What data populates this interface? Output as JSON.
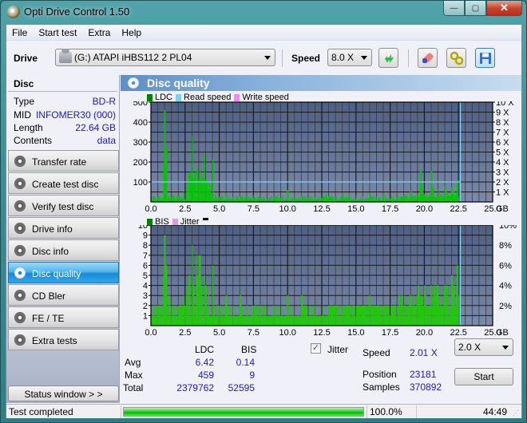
{
  "window": {
    "title": "Opti Drive Control 1.50",
    "buttons": {
      "minimize": "—",
      "maximize": "▢",
      "close": "✕"
    }
  },
  "menu": [
    "File",
    "Start test",
    "Extra",
    "Help"
  ],
  "toolbar": {
    "drive_label": "Drive",
    "drive_value": "(G:)   ATAPI iHBS112   2 PL04",
    "speed_label": "Speed",
    "speed_value": "8.0 X",
    "icons": [
      "refresh-icon",
      "eraser-icon",
      "settings-icon",
      "save-icon"
    ]
  },
  "disc": {
    "heading": "Disc",
    "rows": [
      {
        "label": "Type",
        "value": "BD-R"
      },
      {
        "label": "MID",
        "value": "INFOMER30 (000)"
      },
      {
        "label": "Length",
        "value": "22.64 GB"
      },
      {
        "label": "Contents",
        "value": "data"
      }
    ]
  },
  "nav": {
    "items": [
      {
        "label": "Transfer rate",
        "active": false
      },
      {
        "label": "Create test disc",
        "active": false
      },
      {
        "label": "Verify test disc",
        "active": false
      },
      {
        "label": "Drive info",
        "active": false
      },
      {
        "label": "Disc info",
        "active": false
      },
      {
        "label": "Disc quality",
        "active": true
      },
      {
        "label": "CD Bler",
        "active": false
      },
      {
        "label": "FE / TE",
        "active": false
      },
      {
        "label": "Extra tests",
        "active": false
      }
    ],
    "status_window": "Status window > >"
  },
  "section": {
    "title": "Disc quality"
  },
  "colors": {
    "plot_bg_top": "#4e5f84",
    "plot_bg_bottom": "#7b8aaa",
    "data_green": "#00c800",
    "read_speed": "#7fd0f8",
    "write_speed": "#ff80ff",
    "jitter": "#d8a0d8",
    "ldc_legend": "#008000",
    "bis_legend": "#008000"
  },
  "chart_data": [
    {
      "type": "bar",
      "title": "LDC",
      "legend": [
        "LDC",
        "Read speed",
        "Write speed"
      ],
      "legend_position": "top-left",
      "xlabel": "GB",
      "xlim": [
        0,
        25
      ],
      "x_ticks": [
        "0.0",
        "2.5",
        "5.0",
        "7.5",
        "10.0",
        "12.5",
        "15.0",
        "17.5",
        "20.0",
        "22.5",
        "25.0"
      ],
      "ylim": [
        0,
        500
      ],
      "y_ticks": [
        "100",
        "200",
        "300",
        "400",
        "500"
      ],
      "y2lim": [
        0,
        10
      ],
      "y2_ticks": [
        "1 X",
        "2 X",
        "3 X",
        "4 X",
        "5 X",
        "6 X",
        "7 X",
        "8 X",
        "9 X",
        "10 X"
      ],
      "grid": true,
      "end_marker_gb": 22.64,
      "read_speed_x": 2.0,
      "series": [
        {
          "name": "LDC",
          "x": [
            0.2,
            0.5,
            0.8,
            0.9,
            1.0,
            1.1,
            1.3,
            1.6,
            2.0,
            2.4,
            2.6,
            2.8,
            2.9,
            3.0,
            3.1,
            3.2,
            3.4,
            3.5,
            3.6,
            3.7,
            3.8,
            3.9,
            4.0,
            4.1,
            4.2,
            4.3,
            4.5,
            4.7,
            5.0,
            5.5,
            6.0,
            6.5,
            7.0,
            7.5,
            8.0,
            9.0,
            10.0,
            10.5,
            11.0,
            12.0,
            13.0,
            14.0,
            15.0,
            16.0,
            17.0,
            18.0,
            19.0,
            19.7,
            19.8,
            20.5,
            20.6,
            21.0,
            21.5,
            22.0,
            22.4,
            22.6
          ],
          "values": [
            30,
            25,
            20,
            180,
            459,
            270,
            30,
            35,
            30,
            50,
            100,
            140,
            150,
            330,
            120,
            150,
            170,
            110,
            190,
            120,
            130,
            235,
            110,
            100,
            60,
            90,
            215,
            35,
            25,
            40,
            25,
            30,
            30,
            35,
            25,
            30,
            60,
            30,
            35,
            25,
            30,
            40,
            35,
            45,
            40,
            40,
            55,
            165,
            90,
            155,
            70,
            70,
            80,
            75,
            110,
            60
          ]
        },
        {
          "name": "Read speed",
          "constant": 2.0,
          "unit": "X"
        }
      ]
    },
    {
      "type": "bar",
      "title": "BIS",
      "legend": [
        "BIS",
        "Jitter"
      ],
      "legend_position": "top-left",
      "xlabel": "GB",
      "xlim": [
        0,
        25
      ],
      "x_ticks": [
        "0.0",
        "2.5",
        "5.0",
        "7.5",
        "10.0",
        "12.5",
        "15.0",
        "17.5",
        "20.0",
        "22.5",
        "25.0"
      ],
      "ylim": [
        0,
        10
      ],
      "y_ticks": [
        "1",
        "2",
        "3",
        "4",
        "5",
        "6",
        "7",
        "8",
        "9",
        "10"
      ],
      "y2lim": [
        0,
        10
      ],
      "y2_ticks": [
        "2%",
        "4%",
        "6%",
        "8%",
        "10%"
      ],
      "grid": true,
      "end_marker_gb": 22.64,
      "series": [
        {
          "name": "BIS",
          "x": [
            0.2,
            0.5,
            0.8,
            0.9,
            1.0,
            1.1,
            1.3,
            1.6,
            2.0,
            2.4,
            2.6,
            2.8,
            3.0,
            3.1,
            3.3,
            3.4,
            3.5,
            3.6,
            3.7,
            3.9,
            4.0,
            4.2,
            4.5,
            5.0,
            5.5,
            6.0,
            6.5,
            7.0,
            8.0,
            9.0,
            10.0,
            11.0,
            12.0,
            13.0,
            14.0,
            15.0,
            16.0,
            17.0,
            18.0,
            19.0,
            19.5,
            20.0,
            20.5,
            21.0,
            21.5,
            22.0,
            22.4,
            22.6
          ],
          "values": [
            2,
            2,
            1,
            5,
            9,
            6,
            3,
            2,
            2,
            3,
            4,
            5,
            8,
            4,
            7,
            5,
            7,
            7,
            4,
            5,
            4,
            4,
            6,
            2,
            3,
            2,
            3,
            2,
            2,
            2,
            3,
            3,
            2,
            2,
            2,
            2,
            3,
            2,
            2,
            3,
            4,
            4,
            4,
            4,
            4,
            5,
            6,
            4
          ]
        }
      ]
    }
  ],
  "stats": {
    "headers": [
      "LDC",
      "BIS"
    ],
    "rows": [
      {
        "label": "Avg",
        "ldc": "6.42",
        "bis": "0.14"
      },
      {
        "label": "Max",
        "ldc": "459",
        "bis": "9"
      },
      {
        "label": "Total",
        "ldc": "2379762",
        "bis": "52595"
      }
    ],
    "jitter_label": "Jitter",
    "jitter_checked": true,
    "speed_label": "Speed",
    "speed_value": "2.01 X",
    "speed_select": "2.0 X",
    "position_label": "Position",
    "position_value": "23181",
    "samples_label": "Samples",
    "samples_value": "370892",
    "start_label": "Start"
  },
  "statusbar": {
    "message": "Test completed",
    "progress_percent": 100.0,
    "progress_text": "100.0%",
    "elapsed": "44:49"
  }
}
